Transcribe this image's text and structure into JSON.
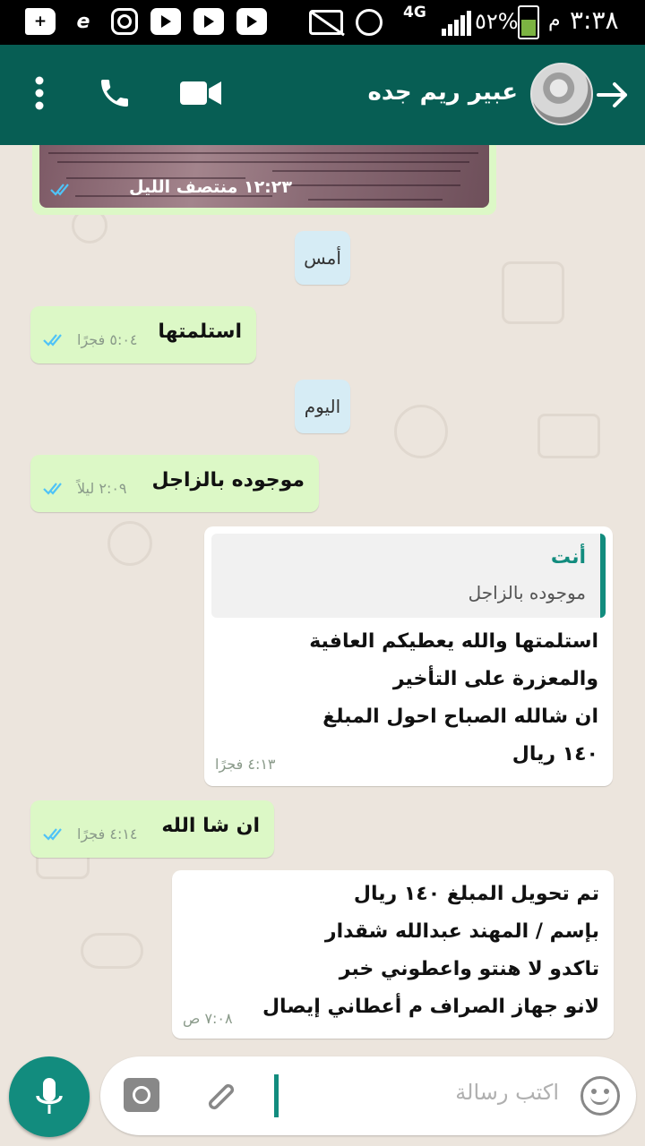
{
  "status_bar": {
    "time": "٣:٣٨",
    "am_pm": "م",
    "battery": "٥٢%",
    "network": "4G"
  },
  "header": {
    "contact_name": "عبير ريم جده",
    "icons": [
      "back-arrow-icon",
      "avatar",
      "video-call-icon",
      "voice-call-icon",
      "more-options-icon"
    ]
  },
  "chat": {
    "image_message": {
      "time": "١٢:٢٣ منتصف الليل"
    },
    "date_yesterday": "أمس",
    "msg1": {
      "text": "استلمتها",
      "time": "٥:٠٤ فجرًا"
    },
    "date_today": "اليوم",
    "msg2": {
      "text": "موجوده بالزاجل",
      "time": "٢:٠٩ ليلاً"
    },
    "msg3": {
      "quote_sender": "أنت",
      "quote_text": "موجوده بالزاجل",
      "lines": [
        "استلمتها والله يعطيكم العافية",
        "والمعزرة على التأخير",
        "ان شالله الصباح احول المبلغ",
        "١٤٠ ريال"
      ],
      "time": "٤:١٣ فجرًا"
    },
    "msg4": {
      "text": "ان شا الله",
      "time": "٤:١٤ فجرًا"
    },
    "msg5": {
      "lines": [
        "تم تحويل المبلغ ١٤٠ ريال",
        "بإسم / المهند عبدالله شقدار",
        "تاكدو لا هنتو واعطوني خبر",
        "لانو جهاز الصراف م أعطاني إيصال"
      ],
      "time": "٧:٠٨ ص"
    }
  },
  "input": {
    "placeholder": "اكتب رسالة"
  },
  "colors": {
    "header": "#075e54",
    "accent": "#128c7e",
    "incoming_bubble": "#dcf8c6",
    "outgoing_bubble": "#ffffff",
    "chat_bg": "#ece5dd",
    "ticks": "#4fc3f7"
  }
}
